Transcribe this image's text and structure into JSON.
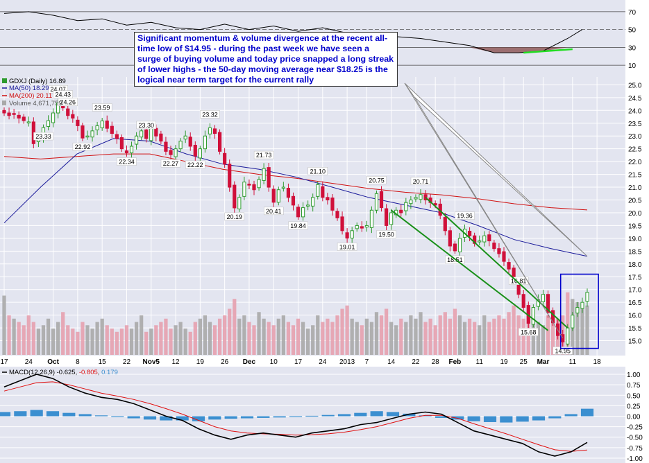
{
  "colors": {
    "panel_bg": "#e3e5f0",
    "grid": "#ffffff",
    "up_candle": "#2e9b2e",
    "down_candle": "#d0103a",
    "ma50": "#1a1a9a",
    "ma200": "#d01010",
    "volume_down": "#e6a0ae",
    "volume_up": "#a8a8a8",
    "channel": "#199019",
    "note_text": "#0000cc",
    "highlight_box": "#0000cc",
    "rsi_line": "#000000",
    "rsi_shade": "#8a5050",
    "macd_line": "#000000",
    "signal_line": "#e01010",
    "histogram": "#3b8fd0"
  },
  "annotation": {
    "text": "Significant momentum & volume divergence at the recent all-time low of $14.95 - during the past week we have seen a surge of buying volume and today price snapped a long streak of lower highs - the 50-day moving average near $18.25 is the logical near term target for the current rally"
  },
  "legend": {
    "ticker": "GDXJ (Daily) 16.89",
    "ma50": "MA(50) 18.29",
    "ma200": "MA(200) 20.11",
    "volume": "Volume 4,671,759",
    "macd_prefix": "MACD(12,26,9)",
    "macd_value": "-0.625",
    "signal_value": "-0.805",
    "hist_value": "0.179"
  },
  "chart_data": [
    {
      "type": "line",
      "panel": "rsi",
      "y_ticks": [
        70,
        50,
        30,
        10
      ],
      "ylim": [
        0,
        80
      ],
      "x": [
        0,
        5,
        10,
        15,
        20,
        25,
        30,
        35,
        40,
        45,
        50,
        55,
        60,
        65,
        70,
        75,
        80,
        85,
        90,
        95,
        100,
        105,
        110,
        115,
        118
      ],
      "values": [
        68,
        70,
        66,
        60,
        62,
        55,
        58,
        52,
        50,
        56,
        50,
        54,
        48,
        52,
        46,
        44,
        42,
        40,
        36,
        32,
        24,
        24,
        26,
        40,
        50
      ],
      "divergence_line": {
        "from": [
          106,
          24
        ],
        "to": [
          116,
          28
        ]
      }
    },
    {
      "type": "candlestick",
      "panel": "price",
      "y_ticks": [
        25.0,
        24.5,
        24.0,
        23.5,
        23.0,
        22.5,
        22.0,
        21.5,
        21.0,
        20.5,
        20.0,
        19.5,
        19.0,
        18.5,
        18.0,
        17.5,
        17.0,
        16.5,
        16.0,
        15.5,
        15.0
      ],
      "ylim": [
        14.5,
        25.2
      ],
      "x_tick_labels": [
        "17",
        "24",
        "Oct",
        "8",
        "15",
        "22",
        "Nov5",
        "12",
        "19",
        "26",
        "Dec",
        "10",
        "17",
        "24",
        "2013",
        "7",
        "14",
        "22",
        "28",
        "Feb",
        "11",
        "19",
        "25",
        "Mar",
        "11",
        "18"
      ],
      "x_tick_index": [
        0,
        5,
        10,
        15,
        20,
        25,
        30,
        35,
        40,
        45,
        50,
        55,
        60,
        65,
        70,
        74,
        79,
        84,
        88,
        92,
        97,
        102,
        106,
        110,
        116,
        121
      ],
      "closes": [
        23.9,
        23.8,
        23.85,
        23.7,
        23.6,
        23.55,
        22.7,
        22.9,
        23.33,
        23.6,
        23.9,
        24.3,
        24.1,
        23.8,
        23.7,
        23.4,
        22.92,
        23.0,
        23.2,
        23.4,
        23.59,
        23.3,
        23.1,
        22.9,
        22.5,
        22.34,
        22.6,
        23.0,
        23.2,
        22.9,
        23.3,
        23.0,
        22.8,
        22.4,
        22.27,
        22.5,
        22.8,
        23.0,
        22.6,
        22.22,
        22.5,
        23.0,
        23.32,
        23.1,
        22.4,
        21.9,
        21.0,
        20.19,
        20.6,
        21.2,
        21.1,
        20.9,
        21.3,
        21.73,
        21.0,
        20.41,
        20.9,
        21.0,
        20.6,
        20.3,
        19.84,
        20.2,
        20.3,
        20.6,
        21.1,
        20.6,
        20.5,
        20.1,
        19.8,
        19.3,
        19.01,
        19.3,
        19.5,
        19.4,
        19.5,
        20.1,
        20.75,
        20.2,
        19.5,
        20.0,
        20.1,
        20.0,
        20.4,
        20.5,
        20.6,
        20.71,
        20.5,
        20.4,
        20.3,
        19.9,
        19.3,
        18.7,
        18.51,
        19.0,
        19.36,
        19.1,
        18.8,
        18.9,
        19.1,
        18.9,
        18.6,
        18.4,
        18.1,
        17.8,
        17.3,
        16.81,
        16.3,
        15.68,
        16.3,
        16.6,
        16.81,
        16.1,
        15.7,
        15.2,
        14.95,
        15.5,
        16.0,
        16.3,
        16.5,
        16.89
      ],
      "price_labels": [
        {
          "i": 8,
          "text": "23.33",
          "pos": "below"
        },
        {
          "i": 11,
          "text": "24.07",
          "pos": "above"
        },
        {
          "i": 12,
          "text": "24.43",
          "pos": "above"
        },
        {
          "i": 13,
          "text": "24.26",
          "pos": "above"
        },
        {
          "i": 16,
          "text": "22.92",
          "pos": "below"
        },
        {
          "i": 20,
          "text": "23.59",
          "pos": "above"
        },
        {
          "i": 25,
          "text": "22.34",
          "pos": "below"
        },
        {
          "i": 29,
          "text": "23.30",
          "pos": "above"
        },
        {
          "i": 34,
          "text": "22.27",
          "pos": "below"
        },
        {
          "i": 39,
          "text": "22.22",
          "pos": "below"
        },
        {
          "i": 42,
          "text": "23.32",
          "pos": "above"
        },
        {
          "i": 47,
          "text": "20.19",
          "pos": "below"
        },
        {
          "i": 53,
          "text": "21.73",
          "pos": "above"
        },
        {
          "i": 55,
          "text": "20.41",
          "pos": "below"
        },
        {
          "i": 60,
          "text": "19.84",
          "pos": "below"
        },
        {
          "i": 64,
          "text": "21.10",
          "pos": "above"
        },
        {
          "i": 70,
          "text": "19.01",
          "pos": "below"
        },
        {
          "i": 76,
          "text": "20.75",
          "pos": "above"
        },
        {
          "i": 78,
          "text": "19.50",
          "pos": "below"
        },
        {
          "i": 85,
          "text": "20.71",
          "pos": "above"
        },
        {
          "i": 92,
          "text": "18.51",
          "pos": "below"
        },
        {
          "i": 94,
          "text": "19.36",
          "pos": "above"
        },
        {
          "i": 105,
          "text": "16.81",
          "pos": "above"
        },
        {
          "i": 107,
          "text": "15.68",
          "pos": "below"
        },
        {
          "i": 114,
          "text": "14.95",
          "pos": "below"
        }
      ],
      "ma50": [
        19.6,
        21.0,
        22.3,
        22.9,
        22.8,
        22.3,
        21.9,
        21.7,
        21.4,
        21.0,
        20.6,
        20.3,
        20.0,
        19.5,
        18.95,
        18.6,
        18.3
      ],
      "ma200": [
        22.2,
        22.1,
        22.2,
        22.3,
        22.3,
        22.0,
        21.7,
        21.5,
        21.35,
        21.15,
        20.95,
        20.8,
        20.7,
        20.55,
        20.35,
        20.2,
        20.11
      ],
      "volume_ratio": [
        0.9,
        0.6,
        0.55,
        0.5,
        0.45,
        0.6,
        0.5,
        0.4,
        0.45,
        0.55,
        0.4,
        0.5,
        0.65,
        0.45,
        0.4,
        0.35,
        0.5,
        0.45,
        0.4,
        0.5,
        0.55,
        0.45,
        0.4,
        0.35,
        0.4,
        0.45,
        0.4,
        0.5,
        0.6,
        0.35,
        0.4,
        0.45,
        0.5,
        0.55,
        0.4,
        0.45,
        0.5,
        0.4,
        0.35,
        0.5,
        0.55,
        0.6,
        0.5,
        0.45,
        0.55,
        0.6,
        0.7,
        0.85,
        0.55,
        0.6,
        0.5,
        0.45,
        0.65,
        0.55,
        0.5,
        0.45,
        0.55,
        0.6,
        0.5,
        0.45,
        0.55,
        0.5,
        0.4,
        0.45,
        0.6,
        0.5,
        0.55,
        0.5,
        0.6,
        0.7,
        0.75,
        0.55,
        0.5,
        0.45,
        0.55,
        0.5,
        0.65,
        0.6,
        0.7,
        0.5,
        0.45,
        0.55,
        0.5,
        0.6,
        0.55,
        0.65,
        0.5,
        0.55,
        0.45,
        0.6,
        0.65,
        0.55,
        0.7,
        0.6,
        0.5,
        0.55,
        0.5,
        0.45,
        0.6,
        0.5,
        0.55,
        0.6,
        0.55,
        0.65,
        0.75,
        0.6,
        0.55,
        0.65,
        0.7,
        0.5,
        0.45,
        0.6,
        0.5,
        0.55,
        0.6,
        0.95,
        0.85,
        0.8,
        0.7,
        0.75
      ],
      "volume_up_flags": [
        1,
        0,
        1,
        0,
        0,
        0,
        0,
        1,
        1,
        1,
        1,
        1,
        0,
        0,
        0,
        0,
        0,
        1,
        1,
        1,
        1,
        0,
        0,
        0,
        0,
        0,
        1,
        1,
        1,
        0,
        1,
        0,
        0,
        0,
        0,
        1,
        1,
        1,
        0,
        0,
        1,
        1,
        1,
        0,
        0,
        0,
        0,
        0,
        1,
        1,
        0,
        0,
        1,
        1,
        0,
        0,
        1,
        1,
        0,
        0,
        0,
        1,
        1,
        1,
        1,
        0,
        0,
        0,
        0,
        0,
        0,
        1,
        1,
        0,
        1,
        1,
        1,
        0,
        0,
        1,
        1,
        0,
        1,
        1,
        1,
        1,
        0,
        0,
        0,
        0,
        0,
        0,
        0,
        1,
        1,
        0,
        0,
        1,
        1,
        0,
        0,
        0,
        0,
        0,
        0,
        0,
        0,
        0,
        1,
        1,
        1,
        0,
        0,
        0,
        0,
        0,
        1,
        1,
        1,
        1,
        1
      ],
      "highlight_box": {
        "from_index": 114,
        "to_index": 120,
        "ymin": 14.7,
        "ymax": 17.6
      }
    },
    {
      "type": "line",
      "panel": "macd",
      "y_ticks": [
        1.0,
        0.75,
        0.5,
        0.25,
        0.0,
        -0.25,
        -0.5,
        -0.75,
        -1.0
      ],
      "ylim": [
        -1.05,
        1.05
      ],
      "macd": [
        0.7,
        0.85,
        1.0,
        0.9,
        0.7,
        0.55,
        0.45,
        0.4,
        0.3,
        0.15,
        0.0,
        -0.1,
        -0.3,
        -0.45,
        -0.55,
        -0.45,
        -0.4,
        -0.45,
        -0.5,
        -0.4,
        -0.35,
        -0.3,
        -0.2,
        -0.15,
        -0.05,
        0.05,
        0.1,
        0.05,
        -0.15,
        -0.35,
        -0.45,
        -0.55,
        -0.65,
        -0.85,
        -0.95,
        -0.85,
        -0.625
      ],
      "signal": [
        0.6,
        0.7,
        0.8,
        0.82,
        0.75,
        0.65,
        0.55,
        0.48,
        0.4,
        0.3,
        0.18,
        0.05,
        -0.1,
        -0.25,
        -0.35,
        -0.4,
        -0.42,
        -0.43,
        -0.45,
        -0.44,
        -0.42,
        -0.38,
        -0.32,
        -0.25,
        -0.15,
        -0.05,
        0.02,
        0.02,
        -0.05,
        -0.18,
        -0.3,
        -0.42,
        -0.55,
        -0.68,
        -0.8,
        -0.84,
        -0.805
      ],
      "histogram": [
        0.1,
        0.12,
        0.15,
        0.12,
        0.08,
        0.05,
        0.02,
        -0.02,
        -0.05,
        -0.08,
        -0.1,
        -0.1,
        -0.12,
        -0.08,
        -0.06,
        -0.05,
        -0.04,
        -0.03,
        -0.02,
        0.01,
        0.03,
        0.05,
        0.08,
        0.12,
        0.1,
        0.06,
        0.02,
        -0.04,
        -0.08,
        -0.12,
        -0.14,
        -0.15,
        -0.13,
        -0.1,
        -0.05,
        0.05,
        0.179
      ]
    }
  ]
}
